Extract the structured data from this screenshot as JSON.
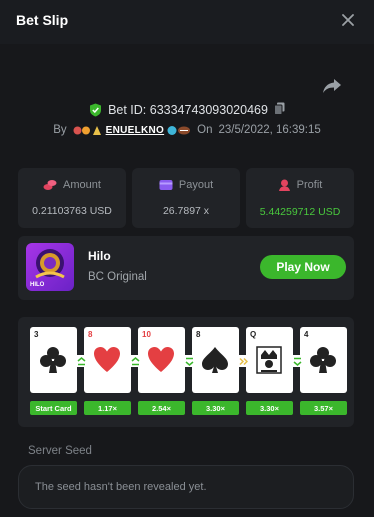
{
  "header": {
    "title": "Bet Slip"
  },
  "bet": {
    "id_label": "Bet ID: 63334743093020469",
    "by_label": "By",
    "username": "ENUELKNO",
    "on_label": "On",
    "datetime": "23/5/2022, 16:39:15"
  },
  "stats": {
    "amount": {
      "label": "Amount",
      "value": "0.21103763 USD"
    },
    "payout": {
      "label": "Payout",
      "value": "26.7897 x"
    },
    "profit": {
      "label": "Profit",
      "value": "5.44259712 USD"
    }
  },
  "game": {
    "name": "Hilo",
    "provider": "BC Original",
    "thumb_text": "HILO",
    "play_label": "Play Now"
  },
  "cards": [
    {
      "rank": "3",
      "suit": "club",
      "color": "blk",
      "multiplier": "Start Card"
    },
    {
      "rank": "8",
      "suit": "heart",
      "color": "red",
      "multiplier": "1.17×",
      "guess": "higher"
    },
    {
      "rank": "10",
      "suit": "heart",
      "color": "red",
      "multiplier": "2.54×",
      "guess": "higher"
    },
    {
      "rank": "8",
      "suit": "spade",
      "color": "blk",
      "multiplier": "3.30×",
      "guess": "lower"
    },
    {
      "rank": "Q",
      "suit": "king",
      "color": "blk",
      "multiplier": "3.30×",
      "guess": "skip"
    },
    {
      "rank": "4",
      "suit": "club",
      "color": "blk",
      "multiplier": "3.57×",
      "guess": "lower"
    }
  ],
  "seed": {
    "label": "Server Seed",
    "placeholder": "The seed hasn't been revealed yet."
  },
  "colors": {
    "accent_green": "#3bb72c",
    "profit_green": "#49c83d",
    "card_red": "#e43f42"
  }
}
